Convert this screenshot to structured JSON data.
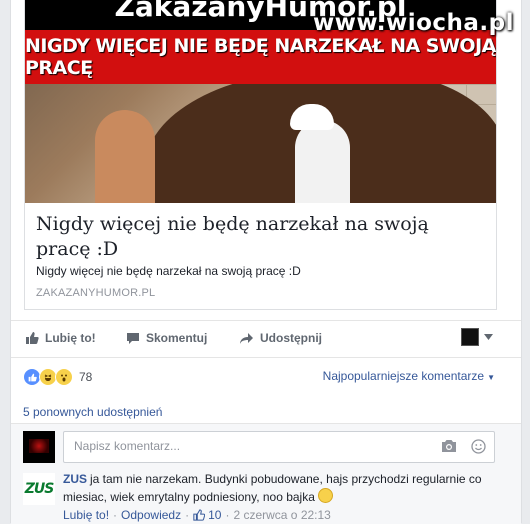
{
  "watermark": "www.wiocha.pl",
  "link_preview": {
    "image_site_text": "ZakazanyHumor.pl",
    "image_banner_text": "NIGDY WIĘCEJ NIE BĘDĘ NARZEKAŁ NA SWOJĄ PRACĘ",
    "title": "Nigdy więcej nie będę narzekał na swoją pracę :D",
    "description": "Nigdy więcej nie będę narzekał na swoją pracę :D",
    "domain": "ZAKAZANYHUMOR.PL"
  },
  "actions": {
    "like": "Lubię to!",
    "comment": "Skomentuj",
    "share": "Udostępnij"
  },
  "reactions": {
    "count": "78",
    "types": [
      "like-icon",
      "haha-icon",
      "wow-icon"
    ]
  },
  "sort_label": "Najpopularniejsze komentarze",
  "shares_text": "5 ponownych udostępnień",
  "comment_box": {
    "placeholder": "Napisz komentarz..."
  },
  "comment": {
    "author": "ZUS",
    "avatar_text": "ZUS",
    "text": "ja tam nie narzekam. Budynki pobudowane, hajs przychodzi regularnie co miesiac, wiek emrytalny podniesiony, noo bajka",
    "like_label": "Lubię to!",
    "reply_label": "Odpowiedz",
    "like_count": "10",
    "timestamp": "2 czerwca o 22:13"
  },
  "colors": {
    "link_blue": "#365899",
    "banner_red": "#d20f0f",
    "zus_green": "#0a7a2f"
  }
}
